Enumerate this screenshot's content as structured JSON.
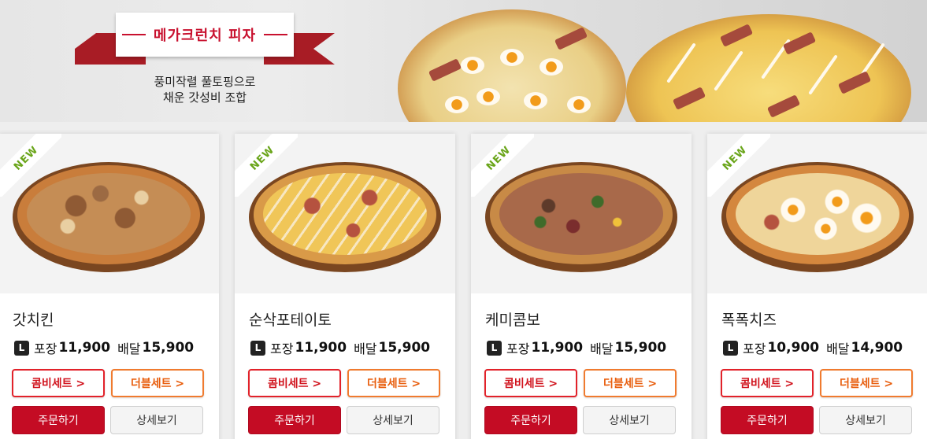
{
  "banner": {
    "title": "메가크런치 피자",
    "subtitle_line1": "풍미작렬 풀토핑으로",
    "subtitle_line2": "채운 갓성비 조합"
  },
  "size_badge": "L",
  "colors": {
    "brand_red": "#c8102e",
    "combo_border": "#e2222a",
    "double_border": "#f07b2f",
    "new_green": "#6aa51a"
  },
  "products": [
    {
      "badge": "NEW",
      "name": "갓치킨",
      "takeout_label": "포장",
      "takeout_price": "11,900",
      "delivery_label": "배달",
      "delivery_price": "15,900",
      "combo_label": "콤비세트 >",
      "double_label": "더블세트 >",
      "order_label": "주문하기",
      "detail_label": "상세보기"
    },
    {
      "badge": "NEW",
      "name": "순삭포테이토",
      "takeout_label": "포장",
      "takeout_price": "11,900",
      "delivery_label": "배달",
      "delivery_price": "15,900",
      "combo_label": "콤비세트 >",
      "double_label": "더블세트 >",
      "order_label": "주문하기",
      "detail_label": "상세보기"
    },
    {
      "badge": "NEW",
      "name": "케미콤보",
      "takeout_label": "포장",
      "takeout_price": "11,900",
      "delivery_label": "배달",
      "delivery_price": "15,900",
      "combo_label": "콤비세트 >",
      "double_label": "더블세트 >",
      "order_label": "주문하기",
      "detail_label": "상세보기"
    },
    {
      "badge": "NEW",
      "name": "폭폭치즈",
      "takeout_label": "포장",
      "takeout_price": "10,900",
      "delivery_label": "배달",
      "delivery_price": "14,900",
      "combo_label": "콤비세트 >",
      "double_label": "더블세트 >",
      "order_label": "주문하기",
      "detail_label": "상세보기"
    }
  ]
}
